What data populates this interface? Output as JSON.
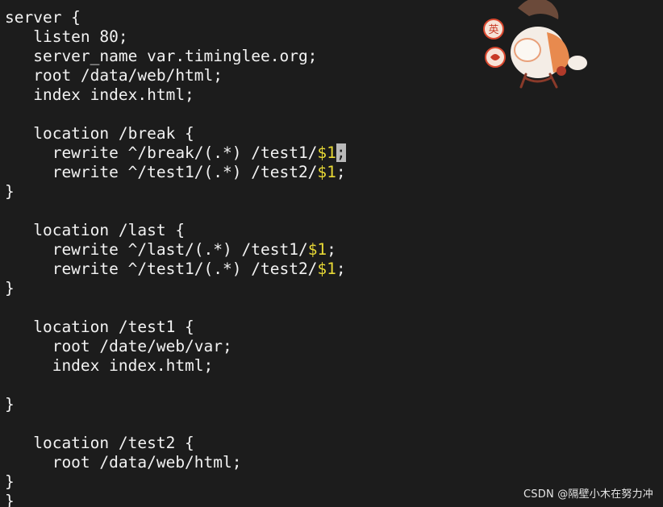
{
  "editor": {
    "lines": [
      {
        "text": "server {"
      },
      {
        "text": "   listen 80;"
      },
      {
        "text": "   server_name var.timinglee.org;"
      },
      {
        "text": "   root /data/web/html;"
      },
      {
        "text": "   index index.html;"
      },
      {
        "text": ""
      },
      {
        "text": "   location /break {"
      },
      {
        "pre": "     rewrite ^/break/(.*) /test1/",
        "var": "$1",
        "cursor": ";",
        "post": ""
      },
      {
        "pre": "     rewrite ^/test1/(.*) /test2/",
        "var": "$1",
        "post": ";"
      },
      {
        "text": "}"
      },
      {
        "text": ""
      },
      {
        "text": "   location /last {"
      },
      {
        "pre": "     rewrite ^/last/(.*) /test1/",
        "var": "$1",
        "post": ";"
      },
      {
        "pre": "     rewrite ^/test1/(.*) /test2/",
        "var": "$1",
        "post": ";"
      },
      {
        "text": "}"
      },
      {
        "text": ""
      },
      {
        "text": "   location /test1 {"
      },
      {
        "text": "     root /date/web/var;"
      },
      {
        "text": "     index index.html;"
      },
      {
        "text": ""
      },
      {
        "text": "}"
      },
      {
        "text": ""
      },
      {
        "text": "   location /test2 {"
      },
      {
        "text": "     root /data/web/html;"
      },
      {
        "text": "}"
      },
      {
        "text": "}"
      }
    ]
  },
  "overlay": {
    "mascot_icon": "chibi-character-sticker",
    "badge_text": "英",
    "watermark": "CSDN @隔壁小木在努力冲"
  },
  "colors": {
    "background": "#1c1c1c",
    "text": "#f2f2f2",
    "variable": "#e8d936",
    "cursor": "#b9b9b9"
  }
}
